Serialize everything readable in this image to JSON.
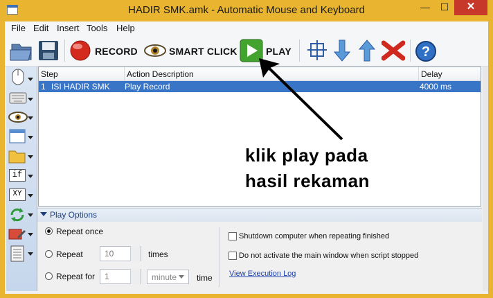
{
  "window": {
    "title": "HADIR SMK.amk - Automatic Mouse and Keyboard",
    "minimize": "—",
    "maximize": "☐",
    "close": "✕"
  },
  "menu": [
    "File",
    "Edit",
    "Insert",
    "Tools",
    "Help"
  ],
  "toolbar": {
    "record_label": "RECORD",
    "smart_click_label": "SMART CLICK",
    "play_label": "PLAY"
  },
  "grid": {
    "columns": [
      "Step",
      "Action Description",
      "Delay"
    ],
    "rows": [
      {
        "step": "1",
        "name": "ISI HADIR SMK",
        "action": "Play Record",
        "delay": "4000 ms"
      }
    ]
  },
  "annotation": {
    "line1": "klik play pada",
    "line2": "hasil rekaman"
  },
  "play_options": {
    "header": "Play Options",
    "repeat_once": "Repeat once",
    "repeat": "Repeat",
    "repeat_value": "10",
    "times": "times",
    "repeat_for": "Repeat for",
    "repeat_for_value": "1",
    "unit": "minute",
    "time": "time",
    "shutdown": "Shutdown computer when repeating finished",
    "no_activate": "Do not activate the main window when script stopped",
    "log_link": "View Execution Log"
  },
  "sidebar_icons": [
    "mouse-icon",
    "keyboard-icon",
    "eye-icon",
    "window-icon",
    "folder-icon",
    "if-icon",
    "xy-icon",
    "repeat-icon",
    "tools-icon",
    "document-icon"
  ],
  "sidebar_text": {
    "if": "if",
    "xy": "XY"
  },
  "colors": {
    "title_bar": "#e9b530",
    "selection": "#3975c6",
    "close_button": "#c7382b",
    "link": "#1a3fb0"
  }
}
